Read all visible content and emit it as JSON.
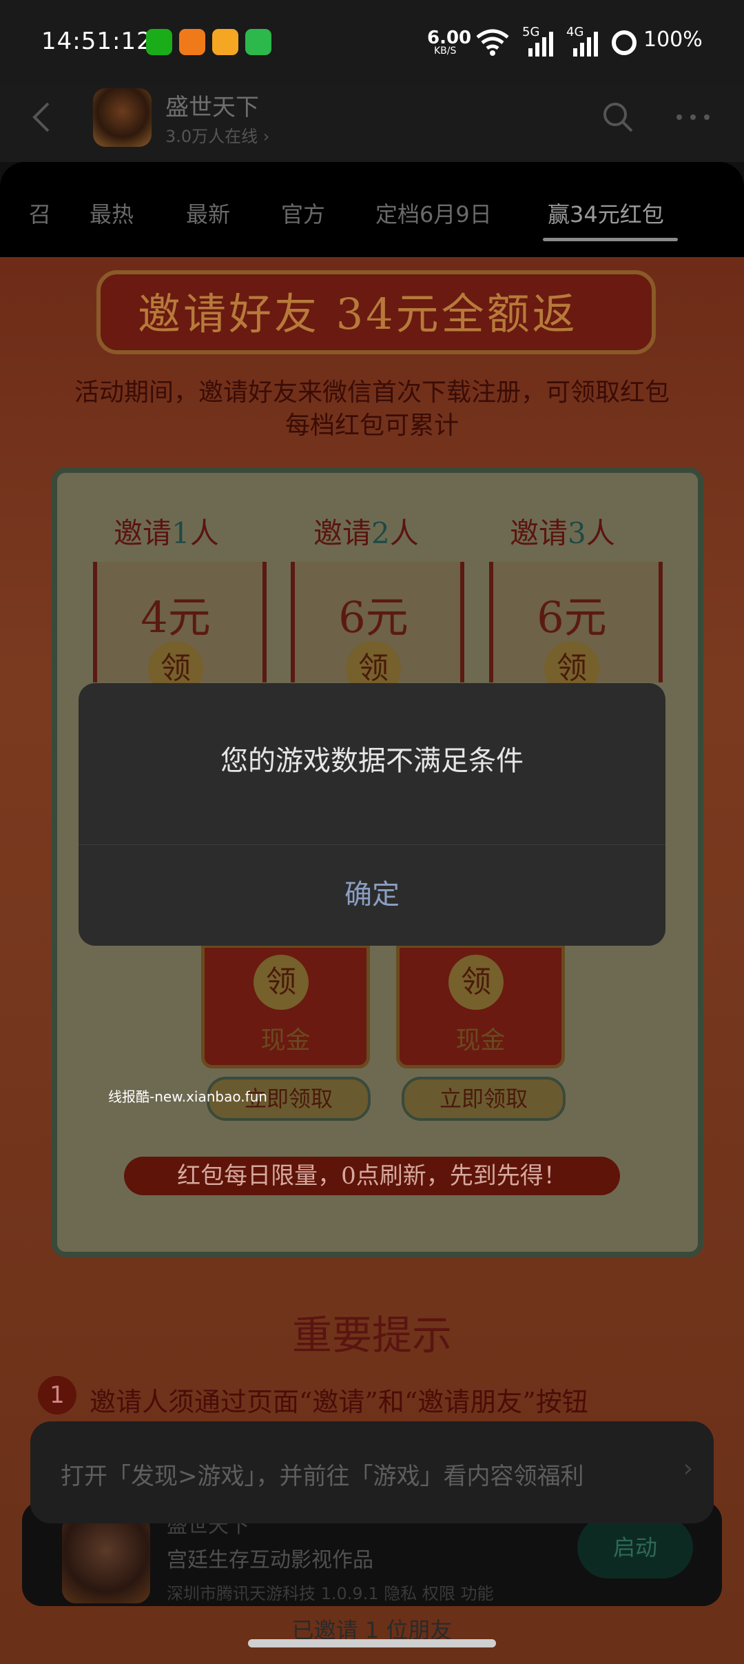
{
  "status_bar": {
    "time": "14:51:12",
    "net_speed": "6.00",
    "net_unit": "KB/S",
    "signal_5g": "5G",
    "signal_4g": "4G",
    "battery": "100%"
  },
  "header": {
    "back_icon": "chevron-left-icon",
    "game_name": "盛世天下",
    "online_count": "3.0万人在线 ›",
    "search_icon": "search-icon",
    "more_icon": "more-dots-icon"
  },
  "tabs": [
    {
      "label": "召",
      "active": false
    },
    {
      "label": "最热",
      "active": false
    },
    {
      "label": "最新",
      "active": false
    },
    {
      "label": "官方",
      "active": false
    },
    {
      "label": "定档6月9日",
      "active": false
    },
    {
      "label": "赢34元红包",
      "active": true
    }
  ],
  "activity": {
    "banner_title": "邀请好友 34元全额返",
    "description_line1": "活动期间，邀请好友来微信首次下载注册，可领取红包",
    "description_line2": "每档红包可累计",
    "tiers": [
      {
        "prefix": "邀请",
        "count": "1",
        "suffix": "人",
        "amount": "4元",
        "claim": "领"
      },
      {
        "prefix": "邀请",
        "count": "2",
        "suffix": "人",
        "amount": "6元",
        "claim": "领"
      },
      {
        "prefix": "邀请",
        "count": "3",
        "suffix": "人",
        "amount": "6元",
        "claim": "领"
      }
    ],
    "lower_envelopes": [
      {
        "claim": "领",
        "cash": "现金",
        "button": "立即领取"
      },
      {
        "claim": "领",
        "cash": "现金",
        "button": "立即领取"
      }
    ],
    "daily_limit": "红包每日限量，0点刷新，先到先得！",
    "important_title": "重要提示",
    "tip_number": "1",
    "tip_1": "邀请人须通过页面“邀请”和“邀请朋友”按钮",
    "watermark": "线报酷-new.xianbao.fun"
  },
  "toast": {
    "text": "打开「发现>游戏」，并前往「游戏」看内容领福利",
    "chevron": "›"
  },
  "game_card": {
    "title": "盛世天下",
    "subtitle": "宫廷生存互动影视作品",
    "info": "深圳市腾讯天游科技 1.0.9.1  隐私  权限  功能",
    "launch_label": "启动",
    "invited_text": "已邀请 1 位朋友"
  },
  "dialog": {
    "message": "您的游戏数据不满足条件",
    "confirm_label": "确定"
  }
}
